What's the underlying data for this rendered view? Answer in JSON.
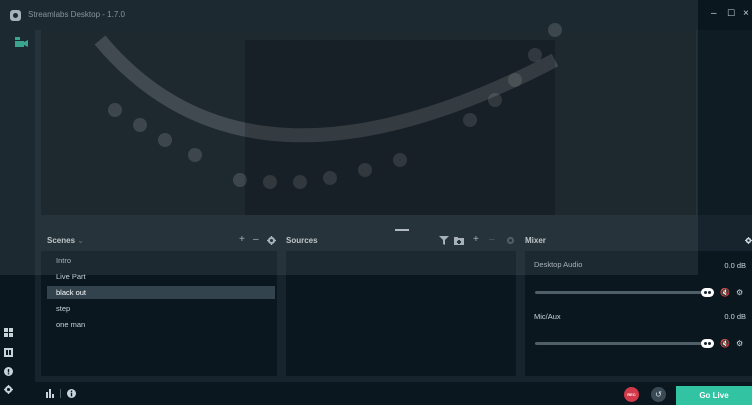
{
  "window": {
    "title": "Streamlabs Desktop - 1.7.0",
    "controls": {
      "minimize": "–",
      "maximize": "☐",
      "close": "×"
    }
  },
  "scenes": {
    "title": "Scenes",
    "dropdown_glyph": "⌄",
    "add": "+",
    "remove": "–",
    "items": [
      "Intro",
      "Live Part",
      "black out",
      "step",
      "one man"
    ],
    "selected_index": 2
  },
  "sources": {
    "title": "Sources",
    "add": "+",
    "remove": "–"
  },
  "mixer": {
    "title": "Mixer",
    "channels": [
      {
        "name": "Desktop Audio",
        "db": "0.0 dB",
        "level": 1.0
      },
      {
        "name": "Mic/Aux",
        "db": "0.0 dB",
        "level": 1.0
      }
    ]
  },
  "footer": {
    "rec_label": "REC",
    "go_live_label": "Go Live"
  },
  "colors": {
    "accent": "#31c3a2",
    "rec": "#d3394a",
    "background": "#17242d",
    "panel": "#0b171f"
  },
  "icons": {
    "studio": "studio-mode-icon",
    "layout": "layout-icon",
    "themes": "themes-icon",
    "help": "help-icon",
    "settings": "settings-icon"
  }
}
